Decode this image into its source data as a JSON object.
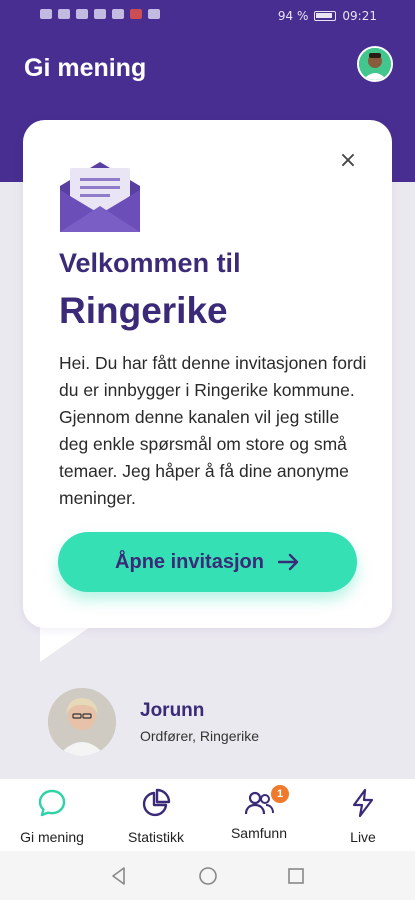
{
  "status_bar": {
    "battery": "94 %",
    "time": "09:21"
  },
  "header": {
    "title": "Gi mening"
  },
  "card": {
    "welcome_line1": "Velkommen til",
    "welcome_line2": "Ringerike",
    "body": "Hei. Du har fått denne invitasjonen fordi du er innbygger i Ringerike kommune. Gjennom denne kanalen vil jeg stille deg enkle spørsmål om store og små temaer. Jeg håper å få dine anonyme meninger.",
    "button_label": "Åpne invitasjon",
    "close_symbol": "×"
  },
  "sender": {
    "name": "Jorunn",
    "role": "Ordfører, Ringerike"
  },
  "bottom_nav": {
    "items": [
      {
        "label": "Gi mening",
        "icon": "chat-bubble-icon",
        "active": true
      },
      {
        "label": "Statistikk",
        "icon": "pie-chart-icon"
      },
      {
        "label": "Samfunn",
        "icon": "people-icon",
        "badge": "1"
      },
      {
        "label": "Live",
        "icon": "lightning-icon"
      }
    ]
  },
  "colors": {
    "brand_purple": "#482e91",
    "accent_teal": "#36e0b5",
    "badge_orange": "#f07a2c"
  }
}
